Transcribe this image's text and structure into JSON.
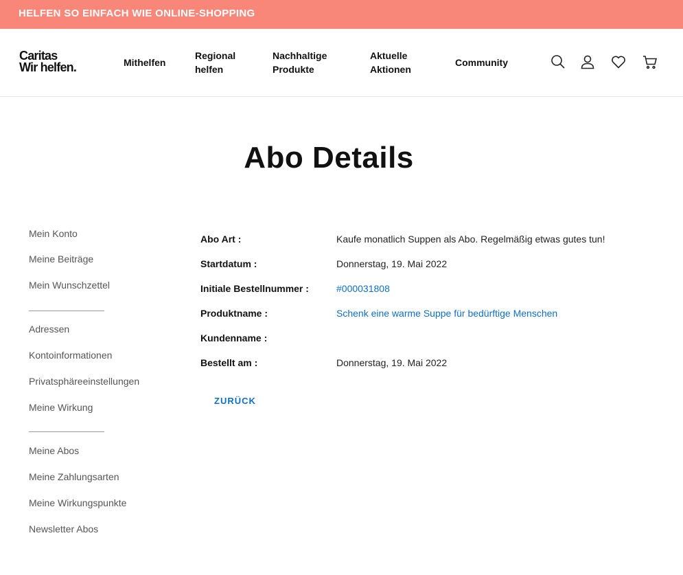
{
  "topbar": {
    "text": "HELFEN SO EINFACH WIE ONLINE-SHOPPING",
    "background": "#f8877a"
  },
  "header": {
    "logo": {
      "line1": "Caritas",
      "line2": "Wir helfen."
    },
    "nav": [
      {
        "label": "Mithelfen"
      },
      {
        "label": "Regional helfen"
      },
      {
        "label": "Nachhaltige Produkte"
      },
      {
        "label": "Aktuelle Aktionen"
      },
      {
        "label": "Community"
      }
    ],
    "icons": [
      "search-icon",
      "user-icon",
      "heart-icon",
      "cart-icon"
    ]
  },
  "page": {
    "title": "Abo Details"
  },
  "sidebar": {
    "groups": [
      [
        "Mein Konto",
        "Meine Beiträge",
        "Mein Wunschzettel"
      ],
      [
        "Adressen",
        "Kontoinformationen",
        "Privatsphäreeinstellungen",
        "Meine Wirkung"
      ],
      [
        "Meine Abos",
        "Meine Zahlungsarten",
        "Meine Wirkungspunkte",
        "Newsletter Abos"
      ]
    ]
  },
  "details": {
    "rows": [
      {
        "label": "Abo Art :",
        "value": "Kaufe monatlich Suppen als Abo. Regelmäßig etwas gutes tun!"
      },
      {
        "label": "Startdatum :",
        "value": "Donnerstag, 19. Mai 2022"
      },
      {
        "label": "Initiale Bestellnummer :",
        "value": "#000031808"
      },
      {
        "label": "Produktname :",
        "value": "Schenk eine warme Suppe für bedürftige Menschen"
      },
      {
        "label": "Kundenname :",
        "value": ""
      },
      {
        "label": "Bestellt am :",
        "value": "Donnerstag, 19. Mai 2022"
      }
    ],
    "back_label": "ZURÜCK"
  },
  "colors": {
    "accent": "#f8877a",
    "link": "#0f6fc6"
  }
}
